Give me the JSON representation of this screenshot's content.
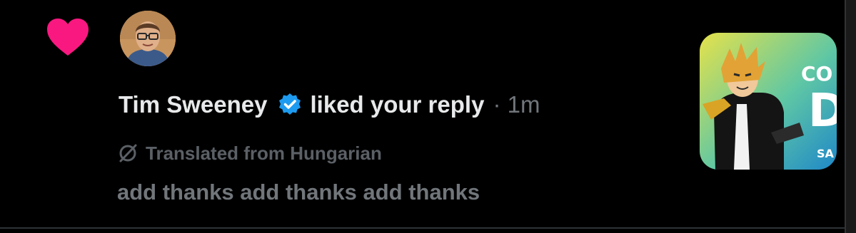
{
  "notification": {
    "type_icon": "heart-icon",
    "accent_color": "#f91880",
    "verified_color": "#1d9bf0",
    "user_name": "Tim Sweeney",
    "verified_icon": "verified-badge-icon",
    "action": "liked your reply",
    "time": "· 1m",
    "translation_icon": "translate-off-icon",
    "translation_note": "Translated from Hungarian",
    "reply_text": "add thanks add thanks add thanks",
    "thumbnail": {
      "icon": "game-thumbnail-icon",
      "text_top": "CO",
      "text_mid": "D",
      "text_bottom": "SA"
    }
  }
}
